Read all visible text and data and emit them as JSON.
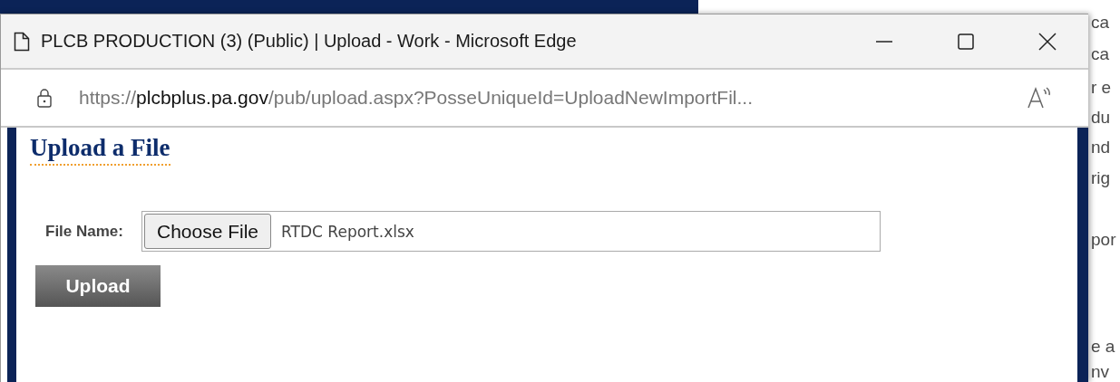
{
  "background_fragments": [
    "ca",
    "ca",
    "r e",
    "du",
    "nd",
    "rig",
    "por",
    "e a",
    "nv"
  ],
  "window": {
    "title": "PLCB PRODUCTION (3) (Public) | Upload - Work - Microsoft Edge"
  },
  "address_bar": {
    "scheme": "https://",
    "host": "plcbplus.pa.gov",
    "path": "/pub/upload.aspx?PosseUniqueId=UploadNewImportFil..."
  },
  "page": {
    "heading": "Upload a File",
    "file_label": "File Name:",
    "choose_button": "Choose File",
    "file_value": "RTDC Report.xlsx",
    "upload_button": "Upload"
  }
}
